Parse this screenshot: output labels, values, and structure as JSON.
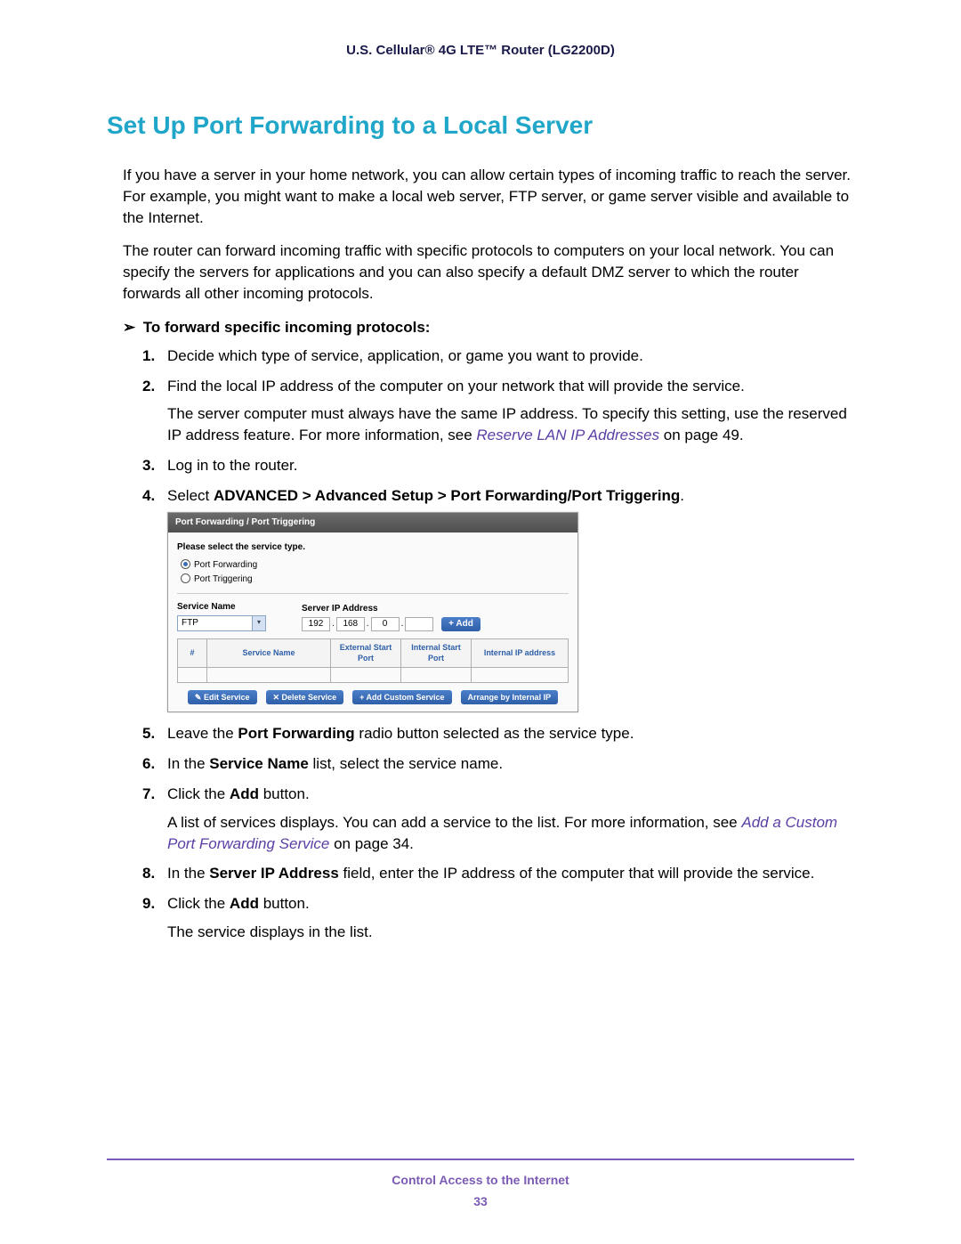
{
  "header": {
    "product": "U.S. Cellular® 4G LTE™ Router (LG2200D)"
  },
  "section": {
    "title": "Set Up Port Forwarding to a Local Server"
  },
  "para1": "If you have a server in your home network, you can allow certain types of incoming traffic to reach the server. For example, you might want to make a local web server, FTP server, or game server visible and available to the Internet.",
  "para2": "The router can forward incoming traffic with specific protocols to computers on your local network. You can specify the servers for applications and you can also specify a default DMZ server to which the router forwards all other incoming protocols.",
  "procedure": {
    "arrow": "➢",
    "heading": "To forward specific incoming protocols:"
  },
  "steps": {
    "s1": "Decide which type of service, application, or game you want to provide.",
    "s2": "Find the local IP address of the computer on your network that will provide the service.",
    "s2_sub_a": "The server computer must always have the same IP address. To specify this setting, use the reserved IP address feature. For more information, see ",
    "s2_link": "Reserve LAN IP Addresses",
    "s2_sub_b": " on page 49.",
    "s3": "Log in to the router.",
    "s4_a": "Select ",
    "s4_b": "ADVANCED > Advanced Setup > Port Forwarding/Port Triggering",
    "s4_c": ".",
    "s5_a": "Leave the ",
    "s5_b": "Port Forwarding",
    "s5_c": " radio button selected as the service type.",
    "s6_a": "In the ",
    "s6_b": "Service Name",
    "s6_c": " list, select the service name.",
    "s7_a": "Click the ",
    "s7_b": "Add",
    "s7_c": " button.",
    "s7_sub_a": "A list of services displays. You can add a service to the list. For more information, see ",
    "s7_link": "Add a Custom Port Forwarding Service",
    "s7_sub_b": " on page 34.",
    "s8_a": "In the ",
    "s8_b": "Server IP Address",
    "s8_c": " field, enter the IP address of the computer that will provide the service.",
    "s9_a": "Click the ",
    "s9_b": "Add",
    "s9_c": " button.",
    "s9_sub": "The service displays in the list."
  },
  "ui": {
    "title": "Port Forwarding / Port Triggering",
    "select_type": "Please select the service type.",
    "radio_fwd": "Port Forwarding",
    "radio_trg": "Port Triggering",
    "service_name_lbl": "Service Name",
    "server_ip_lbl": "Server IP Address",
    "dropdown_value": "FTP",
    "ip1": "192",
    "ip2": "168",
    "ip3": "0",
    "ip4": "",
    "add_btn": "+ Add",
    "th_num": "#",
    "th_service": "Service Name",
    "th_ext": "External Start Port",
    "th_int": "Internal Start Port",
    "th_ip": "Internal IP address",
    "btn_edit": "✎ Edit Service",
    "btn_delete": "✕ Delete Service",
    "btn_custom": "+ Add Custom Service",
    "btn_arrange": "Arrange by Internal IP"
  },
  "footer": {
    "chapter": "Control Access to the Internet",
    "page": "33"
  }
}
